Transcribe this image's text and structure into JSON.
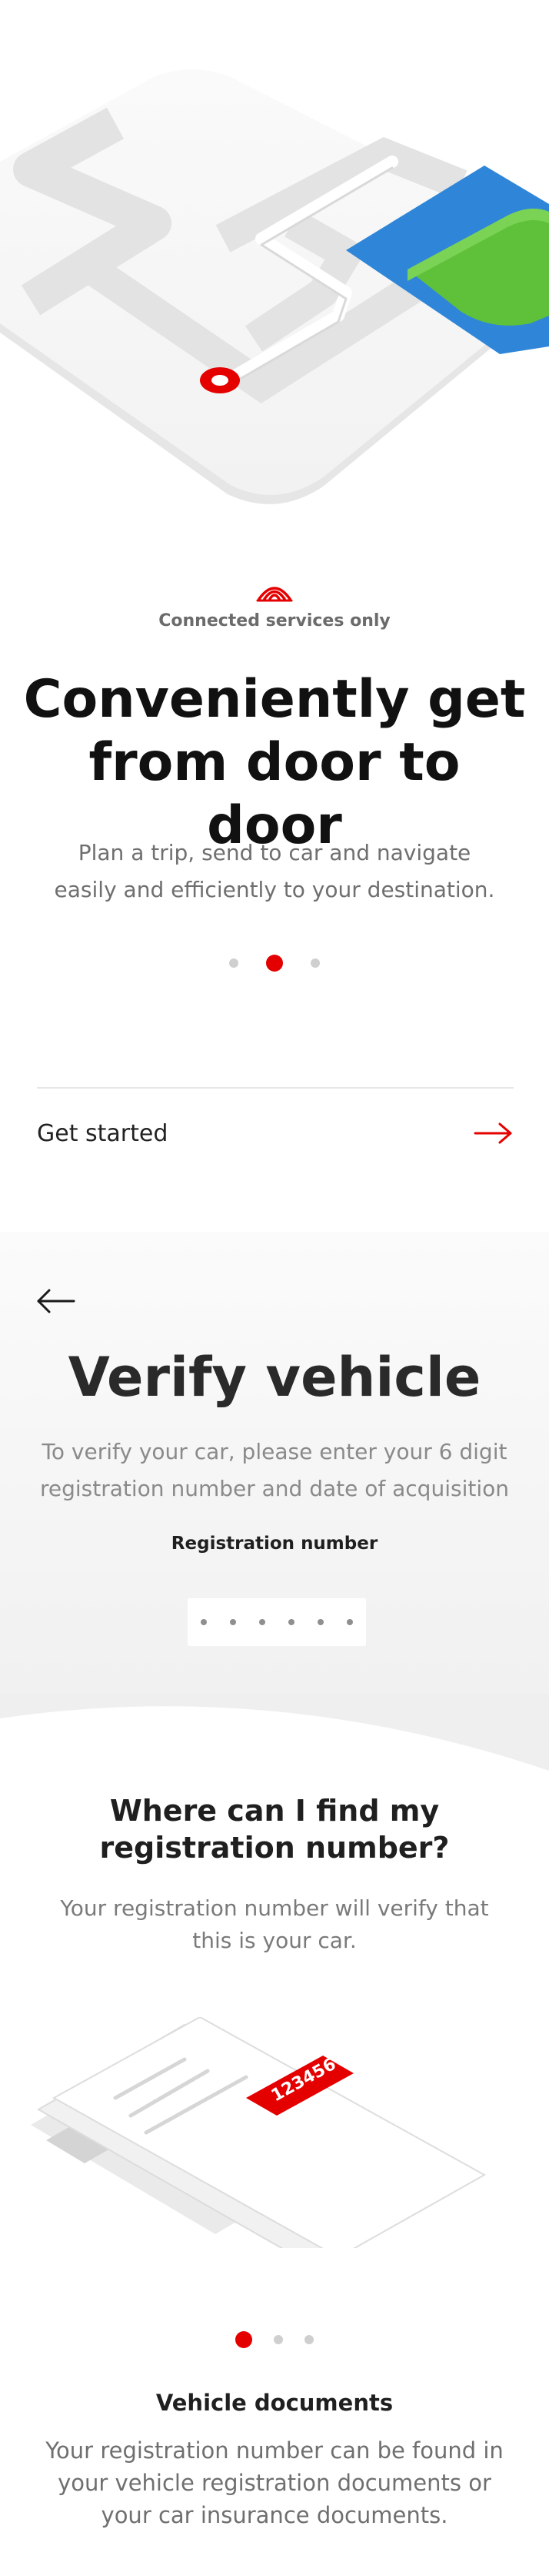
{
  "onboarding": {
    "connected_label": "Connected services only",
    "title": "Conveniently get from door to door",
    "subtitle": "Plan a trip, send to car and navigate easily and efficiently to your destination.",
    "pager": {
      "count": 3,
      "active_index": 1
    },
    "cta_label": "Get started"
  },
  "verify": {
    "title": "Verify vehicle",
    "subtitle": "To verify your car, please enter your 6 digit registration number and date of acquisition",
    "field_label": "Registration number",
    "field_digits": 6,
    "faq_title": "Where can I find my registration number?",
    "faq_subtitle": "Your registration number will verify that this is your car.",
    "illustration_plate_text": "123456",
    "pager": {
      "count": 3,
      "active_index": 0
    },
    "doc_title": "Vehicle documents",
    "doc_subtitle": "Your registration number can be found in your vehicle registration documents or your car insurance documents."
  },
  "colors": {
    "accent": "#e50000",
    "map_blue": "#2f86d8",
    "map_green": "#5fc03a",
    "text_muted": "#6f6f6f"
  },
  "icons": [
    "connected-services-icon",
    "map-pin-icon",
    "arrow-right-icon",
    "arrow-left-icon"
  ]
}
